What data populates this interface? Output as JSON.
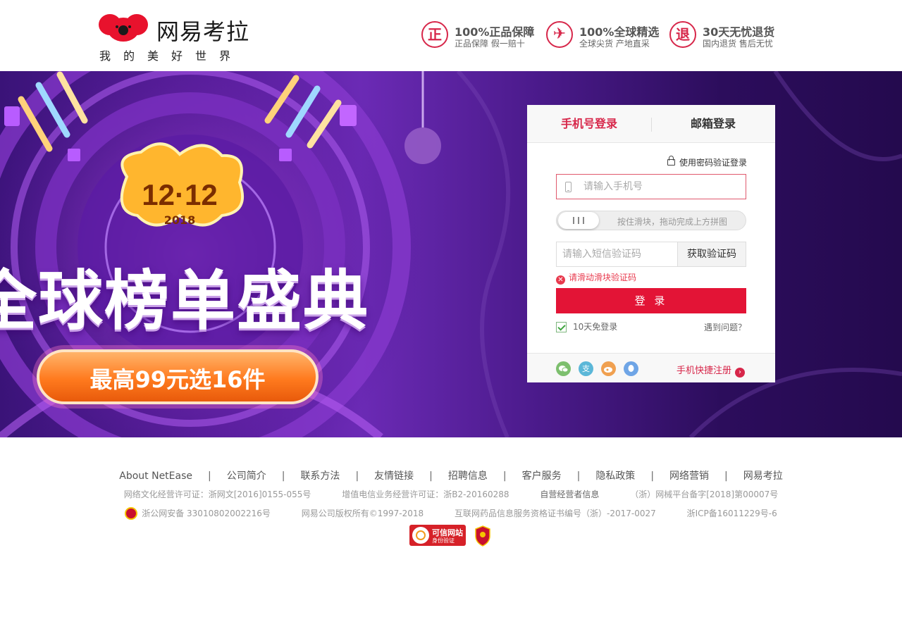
{
  "brand": {
    "name": "网易考拉",
    "slogan": "我的美好世界"
  },
  "promises": [
    {
      "badge": "正",
      "title": "100%正品保障",
      "sub": "正品保障  假一赔十"
    },
    {
      "badge": "✈",
      "title": "100%全球精选",
      "sub": "全球尖货  产地直采"
    },
    {
      "badge": "退",
      "title": "30天无忧退货",
      "sub": "国内退货  售后无忧"
    }
  ],
  "banner": {
    "date": "12·12",
    "year": "2018",
    "headline": "全球榜单盛典",
    "offer": "最高99元选16件"
  },
  "login": {
    "tab_phone": "手机号登录",
    "tab_email": "邮箱登录",
    "password_login_link": "使用密码验证登录",
    "phone_placeholder": "请输入手机号",
    "slider_hint": "按住滑块，拖动完成上方拼图",
    "sms_placeholder": "请输入短信验证码",
    "sms_button": "获取验证码",
    "error_message": "请滑动滑块验证码",
    "submit": "登 录",
    "remember": "10天免登录",
    "trouble": "遇到问题？",
    "register": "手机快捷注册",
    "social": [
      {
        "icon": "wechat-icon",
        "color": "#7dbf6e"
      },
      {
        "icon": "alipay-icon",
        "color": "#5bb7d8"
      },
      {
        "icon": "weibo-icon",
        "color": "#f0a050"
      },
      {
        "icon": "qq-icon",
        "color": "#6fa5e6"
      }
    ]
  },
  "footer": {
    "nav": [
      "About NetEase",
      "公司简介",
      "联系方法",
      "友情链接",
      "招聘信息",
      "客户服务",
      "隐私政策",
      "网络营销",
      "网易考拉"
    ],
    "line1": [
      "网络文化经营许可证：浙网文[2016]0155-055号",
      "增值电信业务经营许可证：浙B2-20160288",
      "自营经营者信息",
      "（浙）网械平台备字[2018]第00007号"
    ],
    "line2": [
      "浙公网安备 33010802002216号",
      "网易公司版权所有©1997-2018",
      "互联网药品信息服务资格证书编号（浙）-2017-0027",
      "浙ICP备16011229号-6"
    ],
    "trust_badge_title": "可信网站",
    "trust_badge_sub": "身份验证"
  }
}
